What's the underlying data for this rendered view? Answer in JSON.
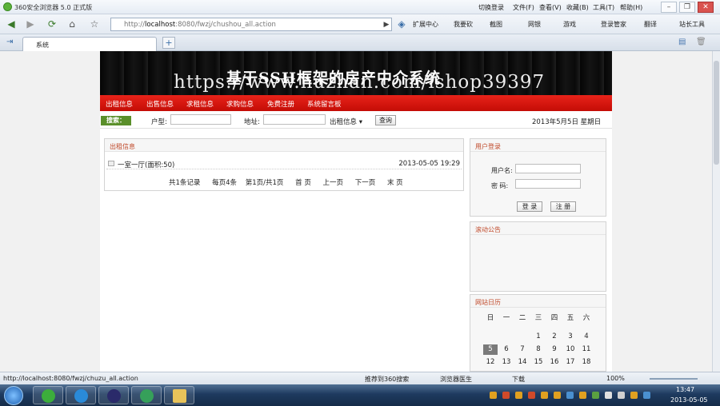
{
  "browser": {
    "title": "360安全浏览器 5.0 正式版",
    "menu": [
      "切换登录",
      "文件(F)",
      "查看(V)",
      "收藏(B)",
      "工具(T)",
      "帮助(H)"
    ],
    "url_prefix": "http://",
    "url_host": "localhost",
    "url_rest": ":8080/fwzj/chushou_all.action",
    "toolbar": [
      "扩展中心",
      "我要砍",
      "截图",
      "网银",
      "游戏",
      "登录管家",
      "翻译",
      "站长工具"
    ],
    "tab_label": "系统"
  },
  "site": {
    "banner_title": "基于SSH框架的房产中介系统",
    "watermark": "https://www.huzhan.com/ishop39397",
    "nav": [
      "出租信息",
      "出售信息",
      "求租信息",
      "求购信息",
      "免费注册",
      "系统留言板"
    ],
    "search_badge": "搜索：",
    "search_type_label": "户型:",
    "search_addr_label": "地址:",
    "search_select": "出租信息",
    "search_button": "查询",
    "date_text": "2013年5月5日  星期日"
  },
  "listing": {
    "header": "出租信息",
    "items": [
      {
        "title": "一室一厅(面积:50)",
        "date": "2013-05-05 19:29"
      }
    ],
    "pager": {
      "total": "共1条记录",
      "per_page": "每页4条",
      "page_of": "第1页/共1页",
      "first": "首 页",
      "prev": "上一页",
      "next": "下一页",
      "last": "末 页"
    }
  },
  "login": {
    "header": "用户登录",
    "username_label": "用户名:",
    "password_label": "密  码:",
    "login_button": "登 录",
    "register_button": "注 册"
  },
  "notice": {
    "header": "滚动公告"
  },
  "calendar": {
    "header": "网站日历",
    "weekdays": [
      "日",
      "一",
      "二",
      "三",
      "四",
      "五",
      "六"
    ],
    "rows": [
      [
        "",
        "",
        "",
        "1",
        "2",
        "3",
        "4"
      ],
      [
        "5",
        "6",
        "7",
        "8",
        "9",
        "10",
        "11"
      ],
      [
        "12",
        "13",
        "14",
        "15",
        "16",
        "17",
        "18"
      ]
    ],
    "today": "5"
  },
  "statusbar": {
    "url": "http://localhost:8080/fwzj/chuzu_all.action",
    "items": [
      "推荐到360搜索",
      "浏览器医生",
      "下载",
      "100%"
    ]
  },
  "taskbar": {
    "time": "13:47",
    "date": "2013-05-05"
  },
  "colors": {
    "nav_red": "#d8140e",
    "badge_green": "#5a8f2a",
    "header_text": "#c0492a"
  }
}
